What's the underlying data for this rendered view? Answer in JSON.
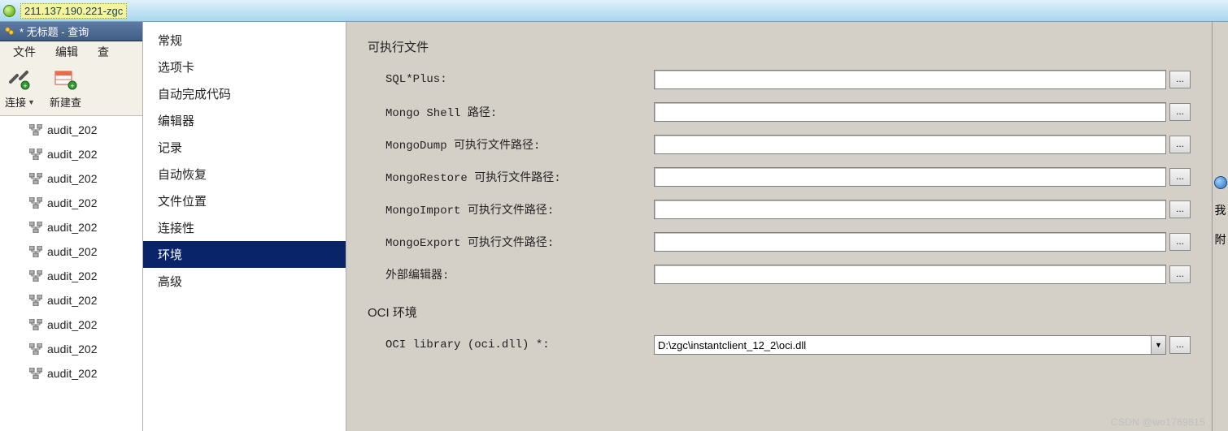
{
  "titlebar": {
    "text": "211.137.190.221-zgc"
  },
  "child_window": {
    "title": "* 无标题 - 查询"
  },
  "menubar": {
    "file": "文件",
    "edit": "编辑",
    "view": "查"
  },
  "toolbar": {
    "connect": "连接",
    "new_query": "新建查"
  },
  "tree": {
    "items": [
      "audit_202",
      "audit_202",
      "audit_202",
      "audit_202",
      "audit_202",
      "audit_202",
      "audit_202",
      "audit_202",
      "audit_202",
      "audit_202",
      "audit_202"
    ]
  },
  "categories": {
    "items": [
      "常规",
      "选项卡",
      "自动完成代码",
      "编辑器",
      "记录",
      "自动恢复",
      "文件位置",
      "连接性",
      "环境",
      "高级"
    ],
    "selected_index": 8
  },
  "panel": {
    "section_exec": "可执行文件",
    "sqlplus": {
      "label": "SQL*Plus:",
      "value": ""
    },
    "mongo_shell": {
      "label": "Mongo Shell 路径:",
      "value": ""
    },
    "mongo_dump": {
      "label": "MongoDump 可执行文件路径:",
      "value": ""
    },
    "mongo_restore": {
      "label": "MongoRestore 可执行文件路径:",
      "value": ""
    },
    "mongo_import": {
      "label": "MongoImport 可执行文件路径:",
      "value": ""
    },
    "mongo_export": {
      "label": "MongoExport 可执行文件路径:",
      "value": ""
    },
    "ext_editor": {
      "label": "外部编辑器:",
      "value": ""
    },
    "section_oci": "OCI 环境",
    "oci_lib": {
      "label": "OCI library (oci.dll) *:",
      "value": "D:\\zgc\\instantclient_12_2\\oci.dll"
    },
    "browse": "..."
  },
  "rightsliver": {
    "char1": "我",
    "char2": "附"
  },
  "watermark": "CSDN @wo1769815"
}
